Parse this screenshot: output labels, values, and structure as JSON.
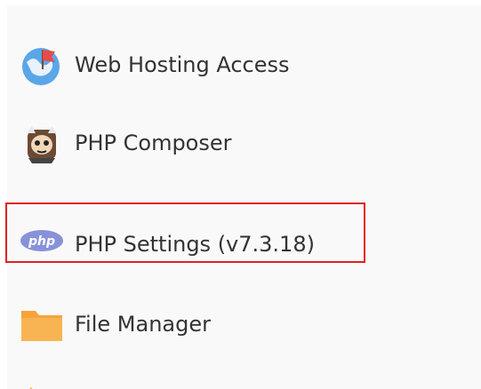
{
  "menu": {
    "items": [
      {
        "label": "Web Hosting Access",
        "icon": "globe-flag-icon"
      },
      {
        "label": "PHP Composer",
        "icon": "composer-icon"
      },
      {
        "label": "PHP Settings (v7.3.18)",
        "icon": "php-icon",
        "highlighted": true
      },
      {
        "label": "File Manager",
        "icon": "folder-icon"
      }
    ]
  },
  "colors": {
    "highlight_border": "#e02020",
    "php_badge": "#8892d9",
    "folder": "#f7a33b",
    "globe": "#5aa6e8",
    "flag": "#e84a4a"
  }
}
